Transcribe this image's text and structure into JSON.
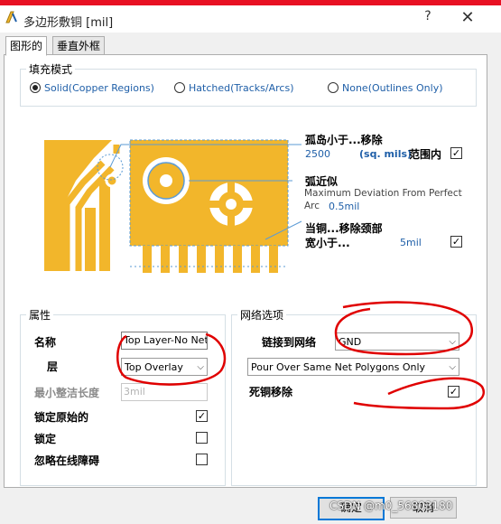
{
  "window": {
    "title": "多边形敷铜 [mil]",
    "help_label": "?",
    "close_label": "✕"
  },
  "tabs": [
    {
      "label": "图形的"
    },
    {
      "label": "垂直外框"
    }
  ],
  "fill_mode": {
    "legend": "填充模式",
    "options": [
      {
        "label": "Solid(Copper Regions)",
        "selected": true
      },
      {
        "label": "Hatched(Tracks/Arcs)",
        "selected": false
      },
      {
        "label": "None(Outlines Only)",
        "selected": false
      }
    ]
  },
  "diagram": {
    "island_title": "孤岛小于...移除",
    "island_value": "2500",
    "island_unit": "(sq. mils)",
    "island_scope": "范围内",
    "island_checked": true,
    "arc_title": "弧近似",
    "arc_desc_1": "Maximum Deviation From Perfect",
    "arc_desc_2": "Arc",
    "arc_value": "0.5mil",
    "neck_title": "当铜...移除颈部",
    "neck_title_2": "宽小于...",
    "neck_value": "5mil",
    "neck_checked": true,
    "copper_color": "#f2b62b"
  },
  "properties": {
    "legend": "属性",
    "name_label": "名称",
    "name_value": "Top Layer-No Net",
    "layer_label": "层",
    "layer_value": "Top Overlay",
    "min_prim_label": "最小整洁长度",
    "min_prim_value": "3mil",
    "lock_prim_label": "锁定原始的",
    "lock_prim_checked": true,
    "lock_label": "锁定",
    "lock_checked": false,
    "ignore_label": "忽略在线障碍",
    "ignore_checked": false
  },
  "net_options": {
    "legend": "网络选项",
    "connect_label": "链接到网络",
    "connect_value": "GND",
    "pour_value": "Pour Over Same Net Polygons Only",
    "remove_dead_label": "死铜移除",
    "remove_dead_checked": true
  },
  "buttons": {
    "ok": "确定",
    "cancel": "取消"
  },
  "watermark": "CSDN @m0_56803180",
  "colors": {
    "accent": "#1f5fa8",
    "annotation_red": "#e00000",
    "title_strip": "#e81123"
  }
}
